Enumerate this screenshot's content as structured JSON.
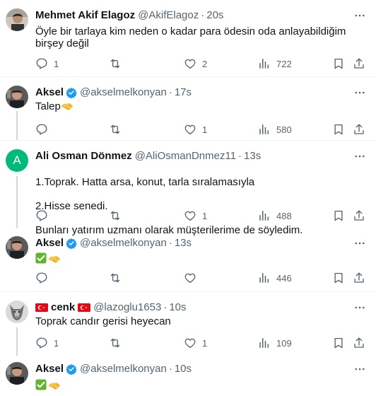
{
  "tweets": [
    {
      "name": "Mehmet Akif Elagoz",
      "handle": "@AkifElagoz",
      "dot": "·",
      "time": "20s",
      "text": "Öyle bir tarlaya kim neden o kadar para ödesin oda anlayabildiğim birşey değil",
      "replies": "1",
      "retweets": "",
      "likes": "2",
      "views": "722"
    },
    {
      "name": "Aksel",
      "handle": "@akselmelkonyan",
      "dot": "·",
      "time": "17s",
      "text": "Talep",
      "replies": "",
      "retweets": "",
      "likes": "1",
      "views": "580"
    },
    {
      "name": "Ali Osman Dönmez",
      "handle": "@AliOsmanDnmez11",
      "dot": "·",
      "time": "13s",
      "avatar_letter": "A",
      "line1": "1.Toprak. Hatta arsa, konut, tarla sıralamasıyla",
      "line2": "2.Hisse senedi.",
      "line3": "Bunları yatırım uzmanı olarak müşterilerime de söyledim.",
      "replies": "",
      "retweets": "",
      "likes": "1",
      "views": "488"
    },
    {
      "name": "Aksel",
      "handle": "@akselmelkonyan",
      "dot": "·",
      "time": "13s",
      "replies": "",
      "retweets": "",
      "likes": "",
      "views": "446"
    },
    {
      "name": "cenk",
      "handle": "@lazoglu1653",
      "dot": "·",
      "time": "10s",
      "text": "Toprak candır gerisi heyecan",
      "replies": "1",
      "retweets": "",
      "likes": "1",
      "views": "109"
    },
    {
      "name": "Aksel",
      "handle": "@akselmelkonyan",
      "dot": "·",
      "time": "10s"
    }
  ],
  "colors": {
    "text": "#0f1419",
    "secondary": "#536471",
    "verified": "#1d9bf0",
    "thread_line": "#cfd9de",
    "divider": "#eff3f4",
    "avatar_a": "#00ba7c"
  },
  "icons": [
    "reply-icon",
    "retweet-icon",
    "like-icon",
    "views-icon",
    "bookmark-icon",
    "share-icon",
    "verified-icon",
    "more-icon",
    "handshake-emoji",
    "check-emoji",
    "turkey-flag"
  ]
}
